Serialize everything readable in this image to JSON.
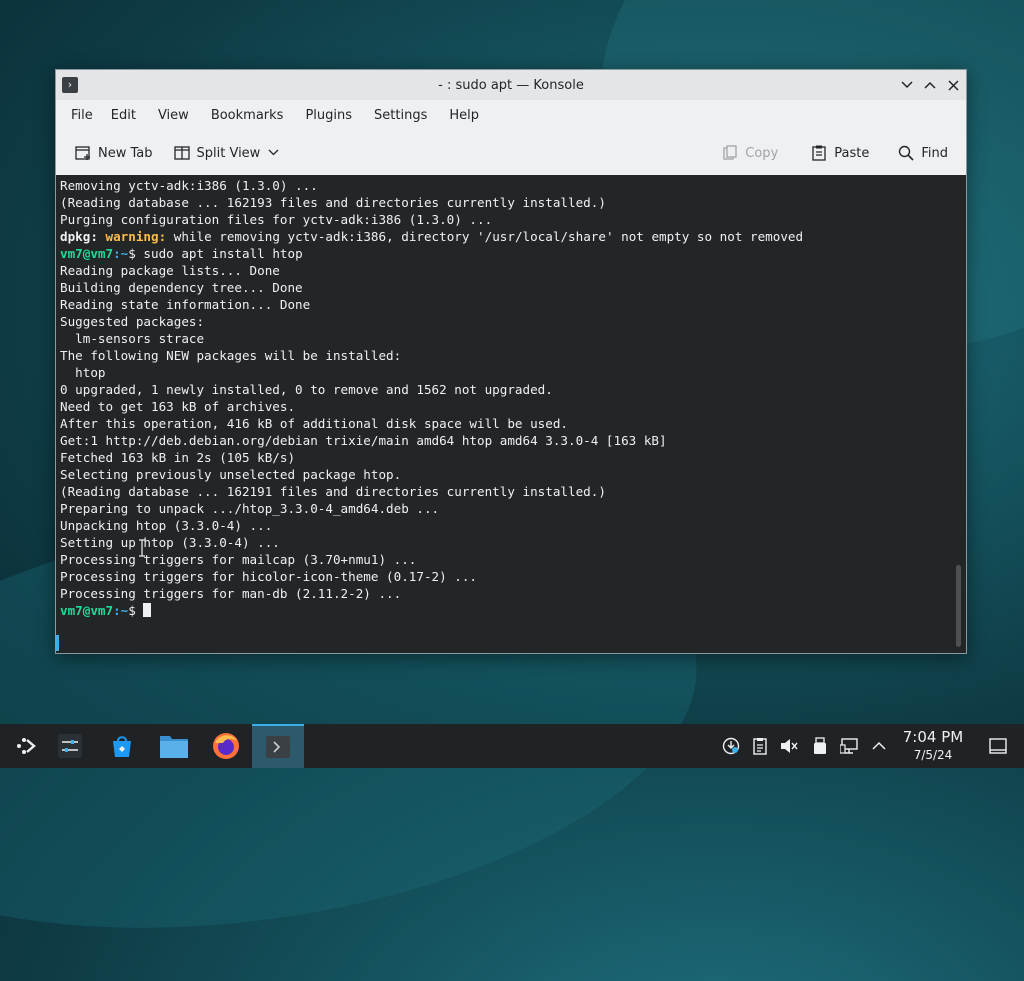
{
  "window": {
    "title": "- : sudo apt — Konsole",
    "menu": [
      "File",
      "Edit",
      "View",
      "Bookmarks",
      "Plugins",
      "Settings",
      "Help"
    ],
    "toolbar": {
      "new_tab": "New Tab",
      "split_view": "Split View",
      "copy": "Copy",
      "paste": "Paste",
      "find": "Find"
    }
  },
  "terminal": {
    "lines": [
      "Removing yctv-adk:i386 (1.3.0) ...",
      "(Reading database ... 162193 files and directories currently installed.)",
      "Purging configuration files for yctv-adk:i386 (1.3.0) ...",
      {
        "dpkg": "dpkg:",
        "warning": "warning:",
        "rest": " while removing yctv-adk:i386, directory '/usr/local/share' not empty so not removed"
      },
      {
        "user": "vm7@vm7",
        "path": ":~",
        "sym": "$ ",
        "cmd": "sudo apt install htop"
      },
      "Reading package lists... Done",
      "Building dependency tree... Done",
      "Reading state information... Done",
      "Suggested packages:",
      "  lm-sensors strace",
      "The following NEW packages will be installed:",
      "  htop",
      "0 upgraded, 1 newly installed, 0 to remove and 1562 not upgraded.",
      "Need to get 163 kB of archives.",
      "After this operation, 416 kB of additional disk space will be used.",
      "Get:1 http://deb.debian.org/debian trixie/main amd64 htop amd64 3.3.0-4 [163 kB]",
      "Fetched 163 kB in 2s (105 kB/s)",
      "Selecting previously unselected package htop.",
      "(Reading database ... 162191 files and directories currently installed.)",
      "Preparing to unpack .../htop_3.3.0-4_amd64.deb ...",
      "Unpacking htop (3.3.0-4) ...",
      "Setting up htop (3.3.0-4) ...",
      "Processing triggers for mailcap (3.70+nmu1) ...",
      "Processing triggers for hicolor-icon-theme (0.17-2) ...",
      "Processing triggers for man-db (2.11.2-2) ...",
      {
        "user": "vm7@vm7",
        "path": ":~",
        "sym": "$ ",
        "cmd": ""
      }
    ]
  },
  "taskbar": {
    "apps": [
      "app-launcher-icon",
      "system-settings-icon",
      "discover-store-icon",
      "file-manager-icon",
      "firefox-icon",
      "konsole-icon"
    ],
    "tray": [
      "updates-icon",
      "clipboard-icon",
      "volume-muted-icon",
      "usb-device-icon",
      "network-icon",
      "show-hidden-icon"
    ],
    "clock_time": "7:04 PM",
    "clock_date": "7/5/24"
  },
  "colors": {
    "terminal_bg": "#232627",
    "prompt": "#1cdc9a",
    "warning": "#fdbc4b",
    "accent": "#3daee9"
  }
}
